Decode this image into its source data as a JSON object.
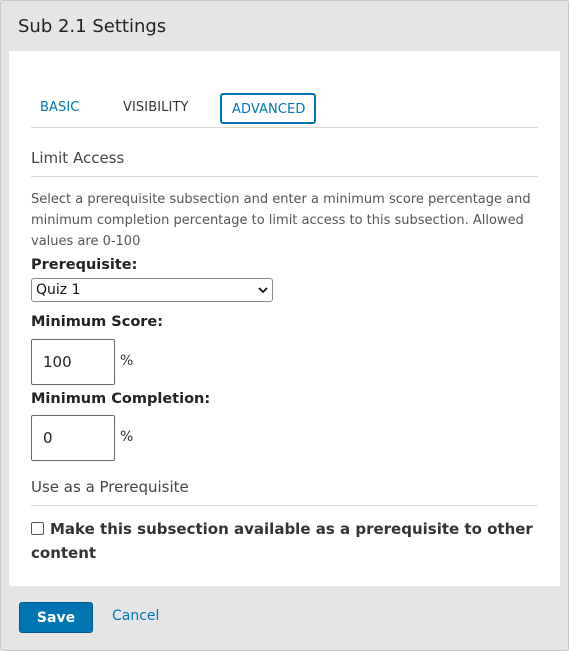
{
  "modal": {
    "title": "Sub 2.1 Settings"
  },
  "tabs": [
    {
      "label": "BASIC"
    },
    {
      "label": "VISIBILITY"
    },
    {
      "label": "ADVANCED"
    }
  ],
  "limit_access": {
    "title": "Limit Access",
    "description": "Select a prerequisite subsection and enter a minimum score percentage and minimum completion percentage to limit access to this subsection. Allowed values are 0-100",
    "prerequisite_label": "Prerequisite:",
    "prerequisite_value": "Quiz 1",
    "min_score_label": "Minimum Score:",
    "min_score_value": "100",
    "min_completion_label": "Minimum Completion:",
    "min_completion_value": "0",
    "percent_symbol": "%"
  },
  "use_prereq": {
    "title": "Use as a Prerequisite",
    "checkbox_label": "Make this subsection available as a prerequisite to other content",
    "checked": false
  },
  "footer": {
    "save_label": "Save",
    "cancel_label": "Cancel"
  },
  "colors": {
    "accent": "#0075b4",
    "header_bg": "#e5e5e5",
    "body_bg": "#ffffff"
  }
}
